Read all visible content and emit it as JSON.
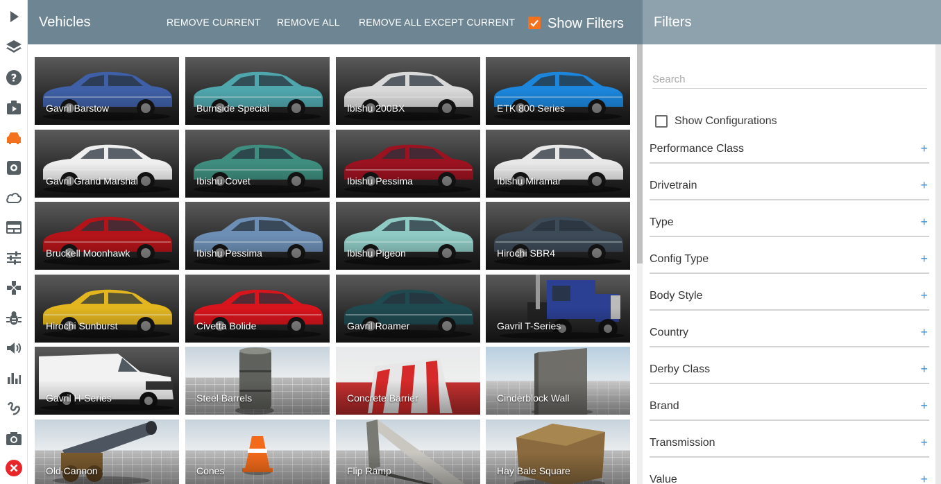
{
  "sidebar": {
    "items": [
      {
        "name": "play-icon"
      },
      {
        "name": "layers-icon"
      },
      {
        "name": "help-icon"
      },
      {
        "name": "scenarios-icon"
      },
      {
        "name": "car-icon"
      },
      {
        "name": "settings-icon"
      },
      {
        "name": "cloud-icon"
      },
      {
        "name": "environment-icon"
      },
      {
        "name": "tuning-icon"
      },
      {
        "name": "controls-icon"
      },
      {
        "name": "debug-bug-icon"
      },
      {
        "name": "audio-icon"
      },
      {
        "name": "stats-icon"
      },
      {
        "name": "track-builder-icon"
      },
      {
        "name": "camera-icon"
      },
      {
        "name": "close-icon"
      }
    ],
    "active": "car-icon",
    "active_color": "#f4711d",
    "close_color": "#e8262a",
    "icon_color": "#555e63"
  },
  "vehicles": {
    "title": "Vehicles",
    "buttons": {
      "remove_current": "REMOVE CURRENT",
      "remove_all": "REMOVE ALL",
      "remove_all_except": "REMOVE ALL EXCEPT CURRENT"
    },
    "show_filters": {
      "label": "Show Filters",
      "checked": true
    },
    "header_color": "#6e8694",
    "tiles": [
      {
        "label": "Gavril Barstow",
        "kind": "car",
        "color": "#3f5fa6"
      },
      {
        "label": "Burnside Special",
        "kind": "car",
        "color": "#4fa6ad"
      },
      {
        "label": "Ibishu 200BX",
        "kind": "car",
        "color": "#d9d9d9"
      },
      {
        "label": "ETK 800 Series",
        "kind": "car",
        "color": "#1b86dc"
      },
      {
        "label": "Gavril Grand Marshal",
        "kind": "car",
        "color": "#efefef"
      },
      {
        "label": "Ibishu Covet",
        "kind": "car",
        "color": "#3e8d7e"
      },
      {
        "label": "Ibishu Pessima",
        "kind": "car",
        "color": "#9b1220"
      },
      {
        "label": "Ibishu Miramar",
        "kind": "car",
        "color": "#e8e8e8"
      },
      {
        "label": "Bruckell Moonhawk",
        "kind": "car",
        "color": "#b41419"
      },
      {
        "label": "Ibishu Pessima",
        "kind": "car",
        "color": "#6d8fb5"
      },
      {
        "label": "Ibishu Pigeon",
        "kind": "car",
        "color": "#8fcac4"
      },
      {
        "label": "Hirochi SBR4",
        "kind": "car",
        "color": "#3d4a57"
      },
      {
        "label": "Hirochi Sunburst",
        "kind": "car",
        "color": "#e3b620"
      },
      {
        "label": "Civetta Bolide",
        "kind": "car",
        "color": "#d8141c"
      },
      {
        "label": "Gavril Roamer",
        "kind": "car",
        "color": "#1f4a50"
      },
      {
        "label": "Gavril T-Series",
        "kind": "truck",
        "color": "#2b3f93"
      },
      {
        "label": "Gavril H-Series",
        "kind": "van",
        "color": "#f2f2f2"
      },
      {
        "label": "Steel Barrels",
        "kind": "barrel",
        "color": "#5f615c"
      },
      {
        "label": "Concrete Barrier",
        "kind": "barrier",
        "color": "#e7e7e7"
      },
      {
        "label": "Cinderblock Wall",
        "kind": "wall",
        "color": "#6f6e69"
      },
      {
        "label": "Old Cannon",
        "kind": "cannon",
        "color": "#4d5560"
      },
      {
        "label": "Cones",
        "kind": "cone",
        "color": "#f26a1a"
      },
      {
        "label": "Flip Ramp",
        "kind": "ramp",
        "color": "#7a7a74"
      },
      {
        "label": "Hay Bale Square",
        "kind": "hay",
        "color": "#8a6a3e"
      }
    ]
  },
  "filters": {
    "title": "Filters",
    "header_color": "#8ea2ad",
    "search_placeholder": "Search",
    "show_configurations": {
      "label": "Show Configurations",
      "checked": false
    },
    "plus_symbol": "+",
    "items": [
      "Performance Class",
      "Drivetrain",
      "Type",
      "Config Type",
      "Body Style",
      "Country",
      "Derby Class",
      "Brand",
      "Transmission",
      "Value"
    ]
  }
}
